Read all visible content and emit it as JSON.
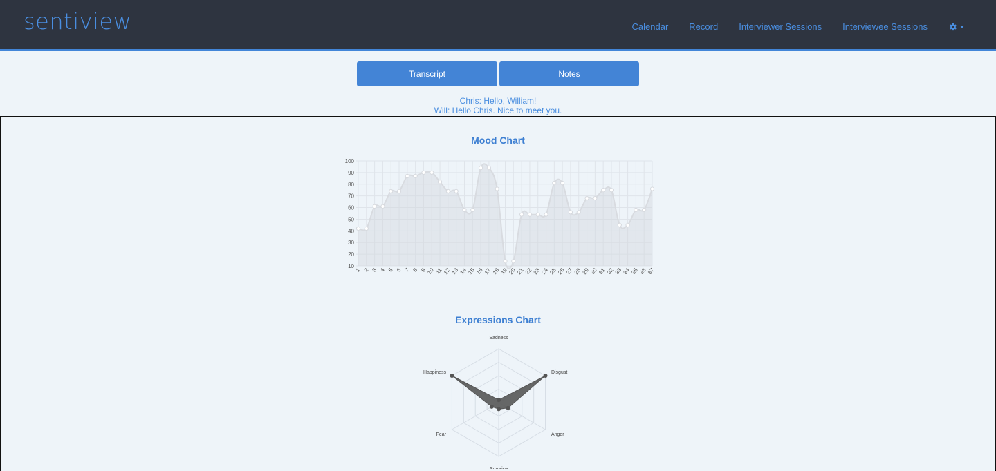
{
  "brand": "sentiview",
  "nav": {
    "items": [
      "Calendar",
      "Record",
      "Interviewer Sessions",
      "Interviewee Sessions"
    ],
    "settings_icon": "gear-icon"
  },
  "buttons": {
    "transcript": "Transcript",
    "notes": "Notes"
  },
  "transcript": {
    "lines": [
      "Chris: Hello, William!",
      "Will: Hello Chris. Nice to meet you."
    ]
  },
  "colors": {
    "navbar": "#2e3440",
    "accent": "#4285d8",
    "button": "#4384d6",
    "background": "#eef4f9"
  },
  "chart_data": [
    {
      "type": "line",
      "title": "Mood Chart",
      "x": [
        "1",
        "2",
        "3",
        "4",
        "5",
        "6",
        "7",
        "8",
        "9",
        "10",
        "11",
        "12",
        "13",
        "14",
        "15",
        "16",
        "17",
        "18",
        "19",
        "20",
        "21",
        "22",
        "23",
        "24",
        "25",
        "26",
        "27",
        "28",
        "29",
        "30",
        "31",
        "32",
        "33",
        "34",
        "35",
        "36",
        "37"
      ],
      "values": [
        42,
        42,
        61,
        61,
        74,
        74,
        87,
        87,
        90,
        90,
        82,
        74,
        74,
        58,
        58,
        94,
        94,
        76,
        14,
        14,
        54,
        54,
        54,
        54,
        81,
        81,
        56,
        56,
        68,
        68,
        75,
        75,
        45,
        45,
        58,
        58,
        76
      ],
      "ylim": [
        10,
        100
      ],
      "yticks": [
        10,
        20,
        30,
        40,
        50,
        60,
        70,
        80,
        90,
        100
      ],
      "grid": true,
      "fill": true
    },
    {
      "type": "radar",
      "title": "Expressions Chart",
      "categories": [
        "Sadness",
        "Disgust",
        "Anger",
        "Surprise",
        "Fear",
        "Happiness"
      ],
      "values": [
        0.05,
        1.0,
        0.2,
        0.12,
        0.15,
        1.0
      ],
      "range": [
        0,
        1
      ]
    }
  ]
}
